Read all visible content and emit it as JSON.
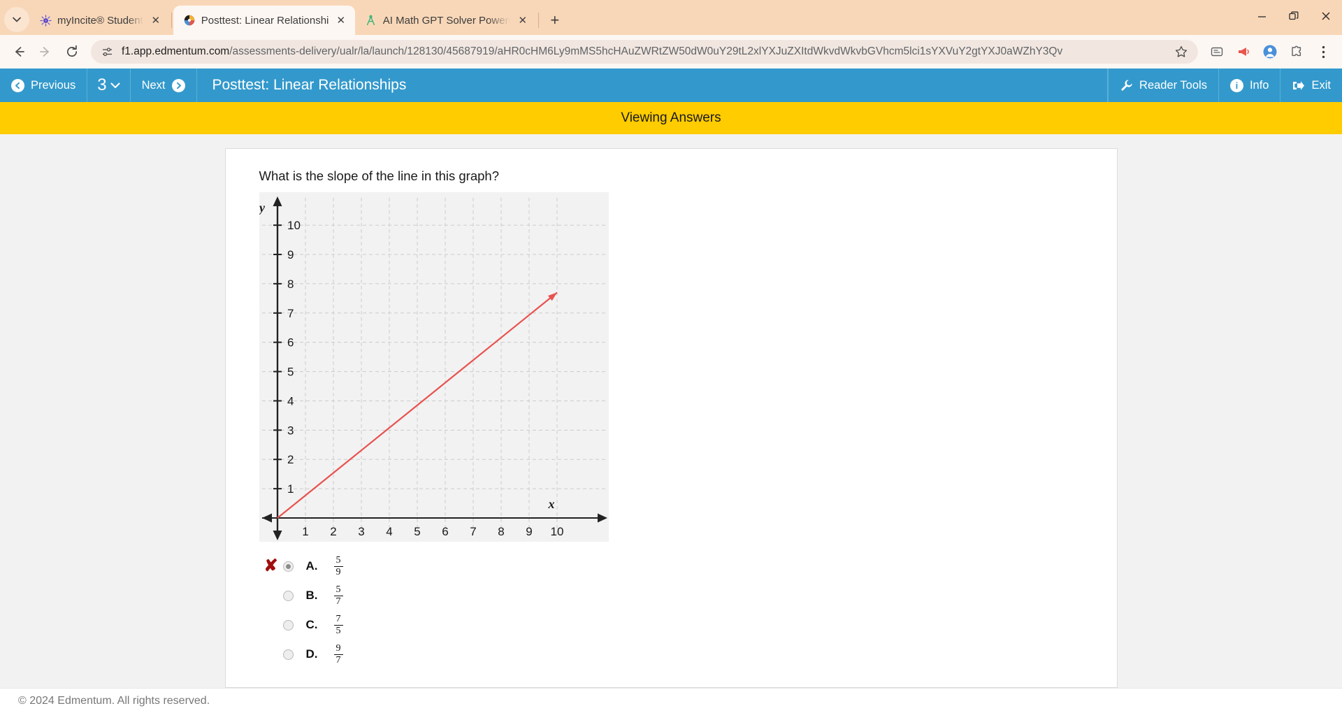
{
  "browser": {
    "tabs": [
      {
        "title": "myIncite® Student",
        "icon": "incite-favicon",
        "active": false
      },
      {
        "title": "Posttest: Linear Relationships",
        "icon": "edmentum-favicon",
        "active": true
      },
      {
        "title": "AI Math GPT Solver Powered by",
        "icon": "compass-favicon",
        "active": false
      }
    ],
    "tab_list_icon": "chevron-down-icon",
    "new_tab_icon": "plus-icon",
    "window_controls": [
      "minimize-icon",
      "restore-icon",
      "close-icon"
    ],
    "nav": {
      "back_icon": "back-arrow-icon",
      "forward_icon": "forward-arrow-icon",
      "reload_icon": "reload-icon"
    },
    "url": {
      "site_info_icon": "site-settings-icon",
      "host": "f1.app.edmentum.com",
      "path": "/assessments-delivery/ualr/la/launch/128130/45687919/aHR0cHM6Ly9mMS5hcHAuZWRtZW50dW0uY29tL2xlYXJuZXItdWkvdWkvbGVhcm5lci1sYXVuY2gtYXJ0aWZhY3Qv",
      "bookmark_icon": "star-icon"
    },
    "extensions": [
      "extension-icon",
      "megaphone-icon",
      "profile-icon",
      "extensions-puzzle-icon",
      "kebab-menu-icon"
    ]
  },
  "toolbar": {
    "previous_label": "Previous",
    "previous_icon": "circle-left-arrow-icon",
    "question_number": "3",
    "question_dropdown_icon": "chevron-down-icon",
    "next_label": "Next",
    "next_icon": "circle-right-arrow-icon",
    "assessment_title": "Posttest: Linear Relationships",
    "reader_tools_label": "Reader Tools",
    "reader_tools_icon": "wrench-icon",
    "info_label": "Info",
    "info_icon": "info-circle-icon",
    "exit_label": "Exit",
    "exit_icon": "exit-arrow-icon"
  },
  "banner": {
    "text": "Viewing Answers",
    "color": "#ffcc00"
  },
  "question": {
    "text": "What is the slope of the line in this graph?"
  },
  "options": [
    {
      "letter": "A.",
      "numerator": "5",
      "denominator": "9",
      "selected": true,
      "mark": "✘"
    },
    {
      "letter": "B.",
      "numerator": "5",
      "denominator": "7",
      "selected": false,
      "mark": ""
    },
    {
      "letter": "C.",
      "numerator": "7",
      "denominator": "5",
      "selected": false,
      "mark": ""
    },
    {
      "letter": "D.",
      "numerator": "9",
      "denominator": "7",
      "selected": false,
      "mark": ""
    }
  ],
  "footer": {
    "copyright": "© 2024 Edmentum. All rights reserved."
  },
  "chart_data": {
    "type": "line",
    "title": "",
    "xlabel": "x",
    "ylabel": "y",
    "xlim": [
      0,
      11
    ],
    "ylim": [
      0,
      10.6
    ],
    "xticks": [
      1,
      2,
      3,
      4,
      5,
      6,
      7,
      8,
      9,
      10
    ],
    "yticks": [
      1,
      2,
      3,
      4,
      5,
      6,
      7,
      8,
      9,
      10
    ],
    "grid": true,
    "grid_color": "#cccccc",
    "line_color": "#e8524f",
    "axis_color": "#222222",
    "plot_background": "#f2f2f2",
    "series": [
      {
        "name": "line",
        "x": [
          0,
          10
        ],
        "y": [
          0,
          7.7
        ],
        "arrow_end": true,
        "slope": 0.77
      }
    ]
  }
}
